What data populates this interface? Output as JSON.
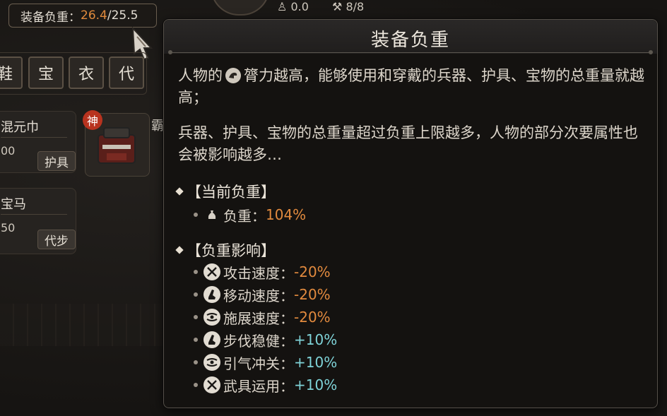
{
  "header": {
    "weight_label": "装备负重：",
    "weight_current": "26.4",
    "weight_sep": "/",
    "weight_max": "25.5",
    "stat_a": "0.0",
    "stat_b": "8/8"
  },
  "tabs": [
    "鞋",
    "宝",
    "衣",
    "代"
  ],
  "cards": [
    {
      "name": "混元巾",
      "value": "00",
      "button": "护具"
    },
    {
      "name": "宝马",
      "value": "50",
      "button": "代步"
    }
  ],
  "item": {
    "badge": "神",
    "side_label": "霸"
  },
  "tooltip": {
    "title": "装备负重",
    "para1_a": "人物的",
    "para1_b": "膂力越高，能够使用和穿戴的兵器、护具、宝物的总重量就越高；",
    "para2": "兵器、护具、宝物的总重量超过负重上限越多，人物的部分次要属性也会被影响越多…",
    "current_section": "【当前负重】",
    "current_label": "负重：",
    "current_value": "104%",
    "effects_section": "【负重影响】",
    "effects": [
      {
        "icon": "crossed-swords-icon",
        "label": "攻击速度：",
        "value": "-20%",
        "sign": "neg"
      },
      {
        "icon": "boot-icon",
        "label": "移动速度：",
        "value": "-20%",
        "sign": "neg"
      },
      {
        "icon": "cast-icon",
        "label": "施展速度：",
        "value": "-20%",
        "sign": "neg"
      },
      {
        "icon": "boot-icon",
        "label": "步伐稳健：",
        "value": "+10%",
        "sign": "pos"
      },
      {
        "icon": "cast-icon",
        "label": "引气冲关：",
        "value": "+10%",
        "sign": "pos"
      },
      {
        "icon": "crossed-swords-icon",
        "label": "武具运用：",
        "value": "+10%",
        "sign": "pos"
      }
    ]
  },
  "colors": {
    "negative": "#e28a3e",
    "positive": "#7fd3d8",
    "accent": "#e08a3c"
  }
}
